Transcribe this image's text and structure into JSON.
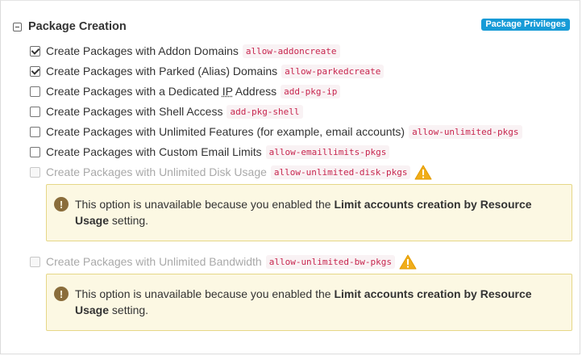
{
  "section": {
    "title": "Package Creation",
    "badge": "Package Privileges"
  },
  "options": [
    {
      "label": "Create Packages with Addon Domains",
      "code": "allow-addoncreate",
      "checked": true,
      "disabled": false
    },
    {
      "label": "Create Packages with Parked (Alias) Domains",
      "code": "allow-parkedcreate",
      "checked": true,
      "disabled": false
    },
    {
      "label_pre": "Create Packages with a Dedicated ",
      "label_abbr": "IP",
      "label_post": " Address",
      "code": "add-pkg-ip",
      "checked": false,
      "disabled": false
    },
    {
      "label": "Create Packages with Shell Access",
      "code": "add-pkg-shell",
      "checked": false,
      "disabled": false
    },
    {
      "label": "Create Packages with Unlimited Features (for example, email accounts)",
      "code": "allow-unlimited-pkgs",
      "checked": false,
      "disabled": false
    },
    {
      "label": "Create Packages with Custom Email Limits",
      "code": "allow-emaillimits-pkgs",
      "checked": false,
      "disabled": false
    },
    {
      "label": "Create Packages with Unlimited Disk Usage",
      "code": "allow-unlimited-disk-pkgs",
      "checked": false,
      "disabled": true
    },
    {
      "label": "Create Packages with Unlimited Bandwidth",
      "code": "allow-unlimited-bw-pkgs",
      "checked": false,
      "disabled": true
    }
  ],
  "notice": {
    "prefix": "This option is unavailable because you enabled the ",
    "bold": "Limit accounts creation by Resource Usage",
    "suffix": " setting."
  },
  "icons": {
    "collapse": "minus-square-icon",
    "warning": "warning-triangle-icon",
    "info": "exclamation-circle-icon"
  },
  "colors": {
    "badge": "#179bd7",
    "code_text": "#c7254e",
    "code_bg": "#f9f2f4",
    "notice_bg": "#fcf8e3",
    "notice_border": "#e6d787",
    "warning": "#f0ad1a"
  }
}
